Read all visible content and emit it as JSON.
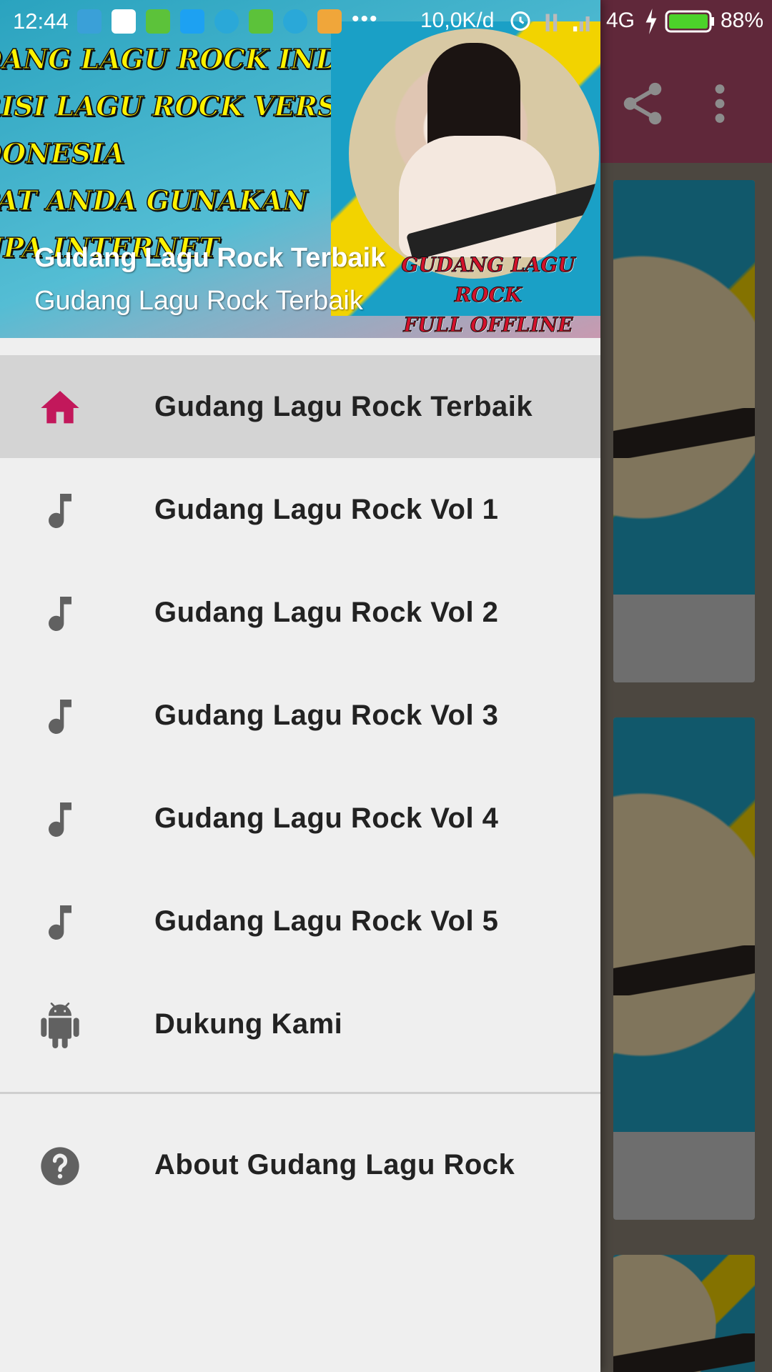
{
  "status_bar": {
    "time": "12:44",
    "dots": "•••",
    "speed": "10,0K/d",
    "network": "4G",
    "battery": "88%",
    "icons": [
      "usb-icon",
      "translate-icon",
      "battery-app-icon",
      "twitter-icon",
      "clock-app-icon",
      "battery-app-icon",
      "clock-app-icon",
      "paint-icon"
    ]
  },
  "drawer": {
    "header": {
      "banner_lines": [
        "DANG LAGU ROCK INDONESIA",
        "RISI LAGU ROCK VERSI",
        "DONESIA",
        "PAT ANDA GUNAKAN",
        "NPA INTERNET"
      ],
      "logo_lines": [
        "GUDANG LAGU ROCK",
        "FULL OFFLINE"
      ],
      "title": "Gudang Lagu Rock Terbaik",
      "subtitle": "Gudang Lagu Rock Terbaik"
    },
    "items": [
      {
        "label": "Gudang Lagu Rock Terbaik",
        "icon": "home-icon",
        "selected": true
      },
      {
        "label": "Gudang Lagu Rock Vol 1",
        "icon": "music-note-icon"
      },
      {
        "label": "Gudang Lagu Rock Vol 2",
        "icon": "music-note-icon"
      },
      {
        "label": "Gudang Lagu Rock Vol 3",
        "icon": "music-note-icon"
      },
      {
        "label": "Gudang Lagu Rock Vol 4",
        "icon": "music-note-icon"
      },
      {
        "label": "Gudang Lagu Rock Vol 5",
        "icon": "music-note-icon"
      },
      {
        "label": "Dukung Kami",
        "icon": "android-icon"
      }
    ],
    "secondary_items": [
      {
        "label": "About Gudang Lagu Rock",
        "icon": "help-icon"
      }
    ]
  },
  "background_app": {
    "toolbar_icons": [
      "share-icon",
      "more-vert-icon"
    ]
  },
  "colors": {
    "accent": "#c2185b",
    "icon_gray": "#616161",
    "drawer_bg": "#efefef",
    "selected_bg": "#d4d4d4",
    "toolbar": "#b04a6a"
  }
}
